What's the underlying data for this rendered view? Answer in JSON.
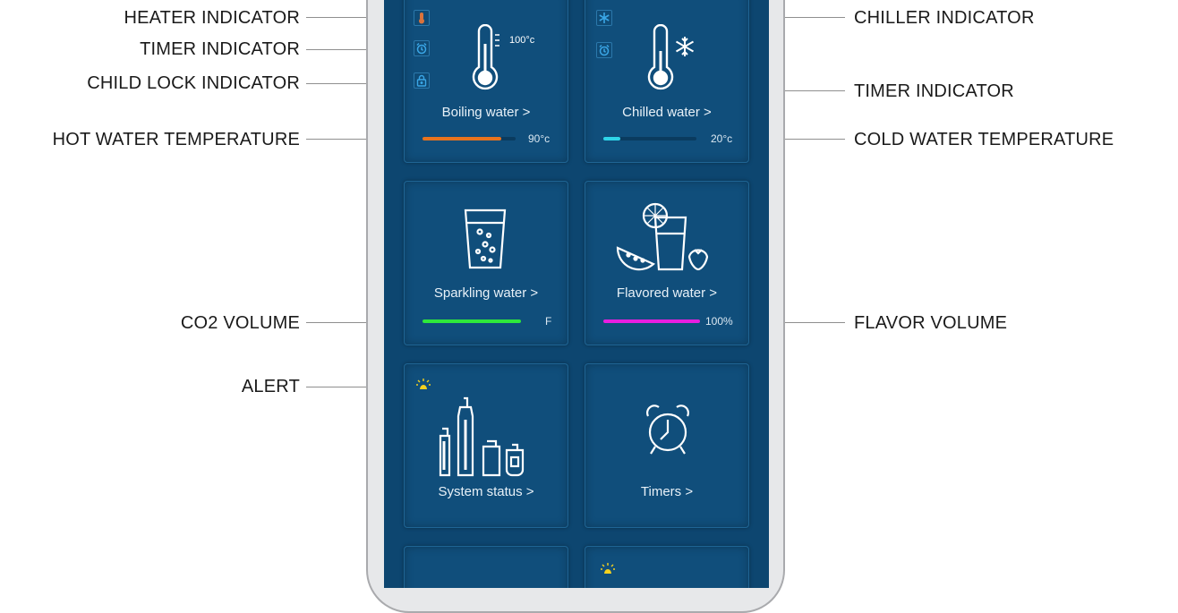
{
  "labels": {
    "heater_indicator": "HEATER INDICATOR",
    "timer_indicator_left": "TIMER INDICATOR",
    "child_lock_indicator": "CHILD LOCK INDICATOR",
    "hot_water_temperature": "HOT WATER TEMPERATURE",
    "co2_volume": "CO2 VOLUME",
    "alert": "ALERT",
    "chiller_indicator": "CHILLER  INDICATOR",
    "timer_indicator_right": "TIMER INDICATOR",
    "cold_water_temperature": "COLD WATER TEMPERATURE",
    "flavor_volume": "FLAVOR VOLUME"
  },
  "tiles": {
    "boiling": {
      "title": "Boiling water  >",
      "setpoint": "100°c",
      "value": "90°c",
      "level": 0.85
    },
    "chilled": {
      "title": "Chilled water  >",
      "value": "20°c",
      "level": 0.18
    },
    "sparkling": {
      "title": "Sparkling water  >",
      "value": "F",
      "level": 1.0
    },
    "flavored": {
      "title": "Flavored water  >",
      "value": "100%",
      "level": 1.0
    },
    "system": {
      "title": "System status  >"
    },
    "timers": {
      "title": "Timers  >"
    }
  },
  "colors": {
    "hot": "#e8731e",
    "cold": "#2fd4e8",
    "co2": "#2ee83b",
    "flavor": "#e81ee0",
    "alert": "#f5d21f",
    "heater_icon": "#d9733c",
    "indicator_blue": "#3aa6e6"
  }
}
